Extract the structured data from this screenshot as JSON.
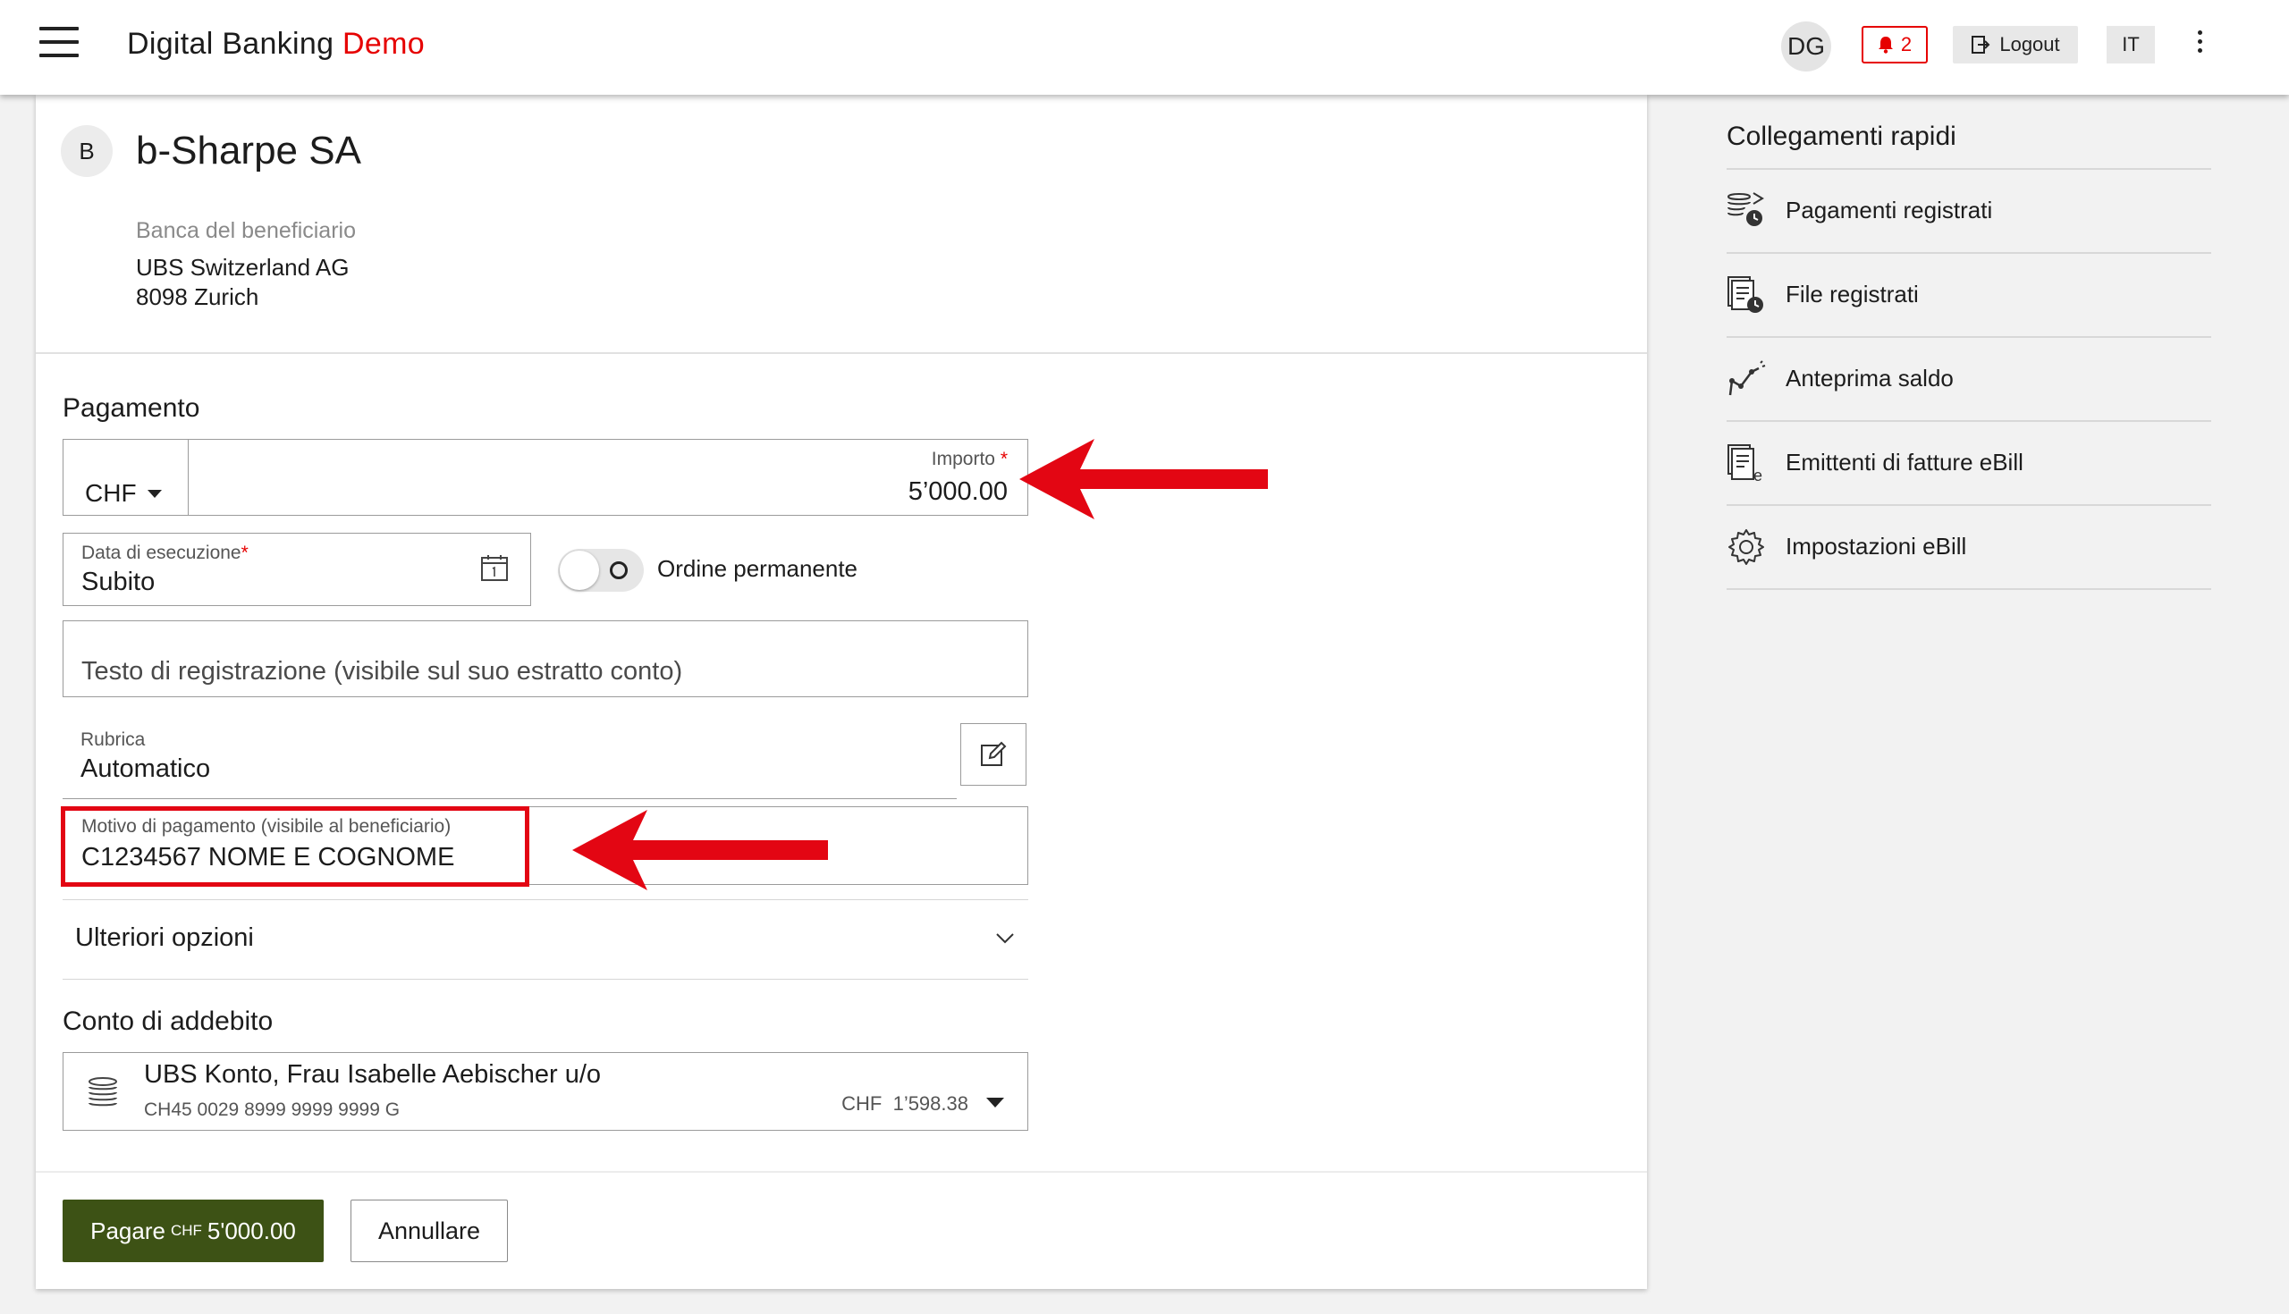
{
  "header": {
    "brand_main": "Digital Banking",
    "brand_accent": "Demo",
    "user_initials": "DG",
    "notifications_count": "2",
    "logout_label": "Logout",
    "language": "IT"
  },
  "beneficiary": {
    "initial": "B",
    "name": "b-Sharpe SA",
    "bank_caption": "Banca del beneficiario",
    "bank_name": "UBS Switzerland AG",
    "bank_city": "8098 Zurich"
  },
  "payment": {
    "section_title": "Pagamento",
    "currency": "CHF",
    "amount_label": "Importo",
    "amount_value": "5’000.00",
    "date_label": "Data di esecuzione",
    "date_value": "Subito",
    "standing_order_label": "Ordine permanente",
    "booking_text_placeholder": "Testo di registrazione (visibile sul suo estratto conto)",
    "address_book_label": "Rubrica",
    "address_book_value": "Automatico",
    "reason_label": "Motivo di pagamento (visibile al beneficiario)",
    "reason_value": "C1234567  NOME E COGNOME",
    "more_options_label": "Ulteriori opzioni"
  },
  "debit": {
    "section_title": "Conto di addebito",
    "account_name": "UBS Konto, Frau Isabelle Aebischer u/o",
    "iban": "CH45 0029 8999 9999 9999 G",
    "balance_currency": "CHF",
    "balance": "1’598.38"
  },
  "actions": {
    "pay_label": "Pagare",
    "pay_currency": "CHF",
    "pay_amount": "5'000.00",
    "cancel_label": "Annullare"
  },
  "quick_links": {
    "title": "Collegamenti rapidi",
    "items": [
      {
        "label": "Pagamenti registrati",
        "icon": "saved-payments-icon"
      },
      {
        "label": "File registrati",
        "icon": "saved-files-icon"
      },
      {
        "label": "Anteprima saldo",
        "icon": "balance-preview-icon"
      },
      {
        "label": "Emittenti di fatture eBill",
        "icon": "ebill-issuers-icon"
      },
      {
        "label": "Impostazioni eBill",
        "icon": "gear-icon"
      }
    ]
  },
  "colors": {
    "accent_red": "#e60000",
    "primary_button": "#3d5215",
    "annotation_red": "#e30613"
  }
}
